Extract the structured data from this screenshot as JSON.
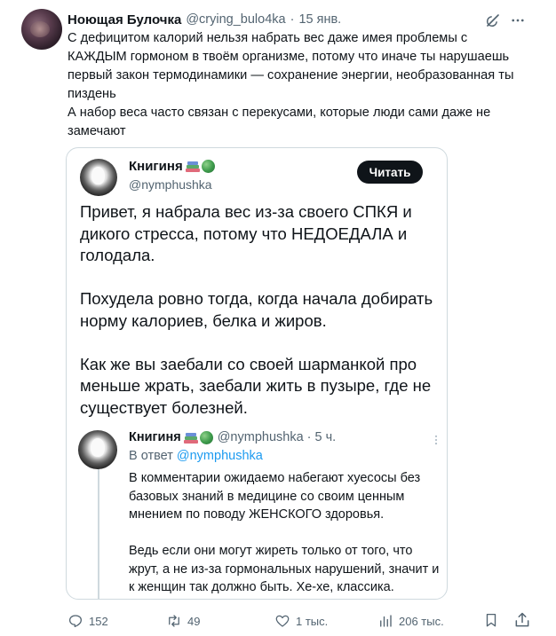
{
  "post": {
    "author_name": "Ноющая Булочка",
    "author_handle": "@crying_bulo4ka",
    "separator": "·",
    "date": "15 янв.",
    "text_lines": [
      "С дефицитом калорий нельзя набрать вес даже имея проблемы с",
      "КАЖДЫМ гормоном в твоём организме,  потому что иначе ты нарушаешь",
      "первый закон термодинамики — сохранение энергии, необразованная ты",
      "пиздень",
      "А набор веса часто связан с перекусами, которые люди сами даже не",
      "замечают"
    ]
  },
  "quote": {
    "author_name": "Книгиня",
    "author_handle": "@nymphushka",
    "follow_label": "Читать",
    "paragraphs": [
      "Привет, я набрала вес из-за своего СПКЯ и дикого стресса, потому что НЕДОЕДАЛА и голодала.",
      "Похудела ровно тогда, когда начала добирать норму калориев, белка и жиров.",
      "Как же вы заебали со своей шарманкой про меньше жрать, заебали жить в пузыре, где не существует болезней."
    ],
    "reply": {
      "author_name": "Книгиня",
      "meta": "@nymphushka · 5 ч.",
      "reply_to_label": "В ответ",
      "reply_to_handle": "@nymphushka",
      "paragraphs": [
        "В комментарии ожидаемо набегают хуесосы без базовых знаний в медицине со своим ценным мнением по поводу ЖЕНСКОГО здоровья.",
        "Ведь если они могут жиреть только от того, что жрут, а не из-за гормональных нарушений, значит и к женщин так должно быть. Хе-хе, классика."
      ]
    }
  },
  "actions": {
    "replies": "152",
    "reposts": "49",
    "likes": "1 тыс.",
    "views": "206 тыс."
  },
  "icons": {
    "grok": "grok-icon",
    "more": "more-icon",
    "reply": "reply-icon",
    "repost": "repost-icon",
    "like": "heart-icon",
    "views": "views-icon",
    "bookmark": "bookmark-icon",
    "share": "share-icon"
  },
  "colors": {
    "text": "#0f1419",
    "secondary": "#536471",
    "link": "#1d9bf0",
    "border": "#cfd9de",
    "button_bg": "#0f1419"
  }
}
